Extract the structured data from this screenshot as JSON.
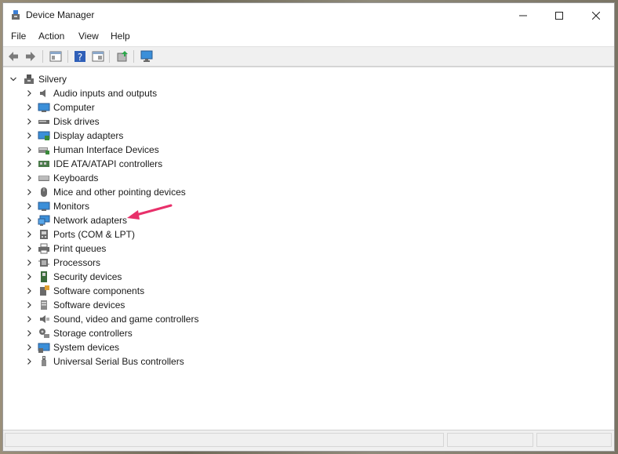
{
  "window": {
    "title": "Device Manager"
  },
  "window_controls": {
    "minimize": "—",
    "maximize": "☐",
    "close": "✕"
  },
  "menu": [
    "File",
    "Action",
    "View",
    "Help"
  ],
  "tree": {
    "root_label": "Silvery",
    "items": [
      {
        "label": "Audio inputs and outputs",
        "icon": "speaker-icon"
      },
      {
        "label": "Computer",
        "icon": "computer-icon"
      },
      {
        "label": "Disk drives",
        "icon": "disk-drive-icon"
      },
      {
        "label": "Display adapters",
        "icon": "display-adapter-icon"
      },
      {
        "label": "Human Interface Devices",
        "icon": "hid-icon"
      },
      {
        "label": "IDE ATA/ATAPI controllers",
        "icon": "ide-controller-icon"
      },
      {
        "label": "Keyboards",
        "icon": "keyboard-icon"
      },
      {
        "label": "Mice and other pointing devices",
        "icon": "mouse-icon"
      },
      {
        "label": "Monitors",
        "icon": "monitor-icon"
      },
      {
        "label": "Network adapters",
        "icon": "network-adapter-icon"
      },
      {
        "label": "Ports (COM & LPT)",
        "icon": "port-icon"
      },
      {
        "label": "Print queues",
        "icon": "printer-icon"
      },
      {
        "label": "Processors",
        "icon": "processor-icon"
      },
      {
        "label": "Security devices",
        "icon": "security-device-icon"
      },
      {
        "label": "Software components",
        "icon": "software-component-icon"
      },
      {
        "label": "Software devices",
        "icon": "software-device-icon"
      },
      {
        "label": "Sound, video and game controllers",
        "icon": "sound-controller-icon"
      },
      {
        "label": "Storage controllers",
        "icon": "storage-controller-icon"
      },
      {
        "label": "System devices",
        "icon": "system-device-icon"
      },
      {
        "label": "Universal Serial Bus controllers",
        "icon": "usb-icon"
      }
    ]
  },
  "colors": {
    "accent_arrow": "#e8306a",
    "toolbar_bg": "#f0f0f0"
  }
}
